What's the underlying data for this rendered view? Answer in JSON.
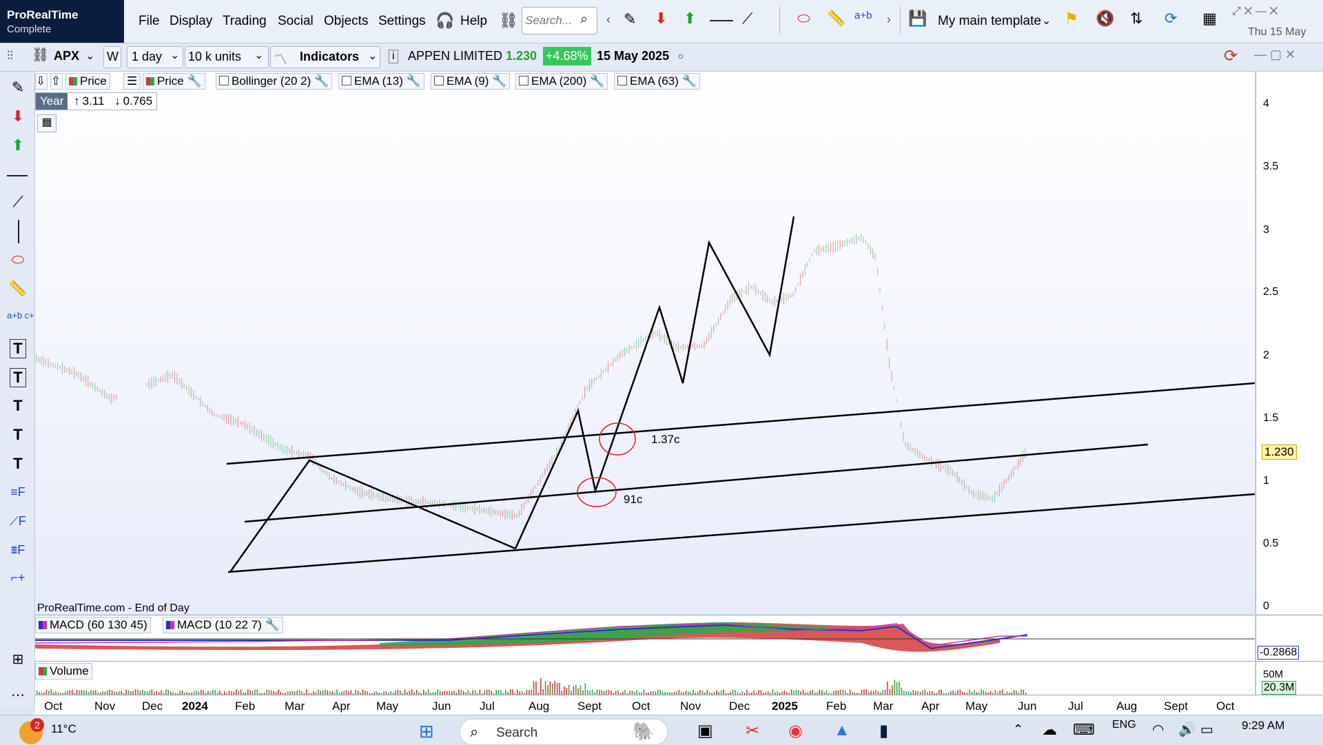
{
  "app": {
    "name": "ProRealTime",
    "edition": "Complete"
  },
  "menu": [
    "File",
    "Display",
    "Trading",
    "Social",
    "Objects",
    "Settings"
  ],
  "help_label": "Help",
  "search_placeholder": "Search...",
  "template_label": "My main template",
  "datetime": "Thu 15 May",
  "toolbar": {
    "symbol": "APX",
    "period_letter": "W",
    "interval": "1 day",
    "units": "10 k units",
    "indicators_label": "Indicators",
    "instrument_name": "APPEN LIMITED",
    "last_price": "1.230",
    "change": "+4.68%",
    "date": "15 May 2025"
  },
  "overlays": [
    {
      "label": "Price",
      "kind": "color"
    },
    {
      "label": "Price",
      "kind": "color"
    },
    {
      "label": "Bollinger (20 2)",
      "kind": "check"
    },
    {
      "label": "EMA (13)",
      "kind": "check"
    },
    {
      "label": "EMA (9)",
      "kind": "check"
    },
    {
      "label": "EMA (200)",
      "kind": "check"
    },
    {
      "label": "EMA (63)",
      "kind": "check"
    }
  ],
  "period_stats": {
    "label": "Year",
    "high": "3.11",
    "low": "0.765"
  },
  "source_note": "ProRealTime.com - End of Day",
  "annotations": {
    "upper": "1.37c",
    "lower": "91c"
  },
  "y_ticks": [
    "4",
    "3.5",
    "3",
    "2.5",
    "2",
    "1.5",
    "1",
    "0.5",
    "0"
  ],
  "price_badge": "1.230",
  "macd": {
    "labels": [
      "MACD (60 130 45)",
      "MACD (10 22 7)"
    ],
    "value": "-0.2868"
  },
  "volume": {
    "label": "Volume",
    "tick": "50M",
    "value": "20.3M"
  },
  "x_labels": [
    "Oct",
    "Nov",
    "Dec",
    "2024",
    "Feb",
    "Mar",
    "Apr",
    "May",
    "Jun",
    "Jul",
    "Aug",
    "Sept",
    "Oct",
    "Nov",
    "Dec",
    "2025",
    "Feb",
    "Mar",
    "Apr",
    "May",
    "Jun",
    "Jul",
    "Aug",
    "Sept",
    "Oct"
  ],
  "taskbar": {
    "weather_temp": "11°C",
    "badge": "2",
    "search_label": "Search",
    "lang": "ENG",
    "time": "9:29 AM"
  },
  "colors": {
    "up": "#2fa84a",
    "down": "#d23b3b",
    "change_bg": "#34c759",
    "badge_bg": "#fff3a0"
  }
}
